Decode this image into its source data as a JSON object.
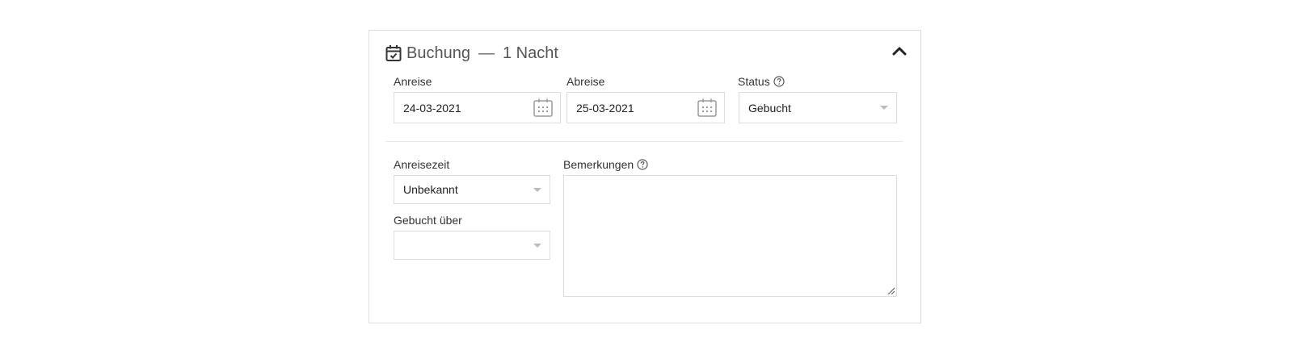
{
  "header": {
    "title": "Buchung",
    "separator": "—",
    "nights": "1 Nacht"
  },
  "booking": {
    "arrival_label": "Anreise",
    "arrival_value": "24-03-2021",
    "departure_label": "Abreise",
    "departure_value": "25-03-2021",
    "status_label": "Status",
    "status_value": "Gebucht",
    "arrival_time_label": "Anreisezeit",
    "arrival_time_value": "Unbekannt",
    "booked_via_label": "Gebucht über",
    "booked_via_value": "",
    "remarks_label": "Bemerkungen",
    "remarks_value": ""
  },
  "icons": {
    "header": "calendar-check-icon",
    "collapse": "chevron-up-icon",
    "date": "calendar-icon",
    "help": "question-circle-icon",
    "select": "caret-down-icon"
  }
}
